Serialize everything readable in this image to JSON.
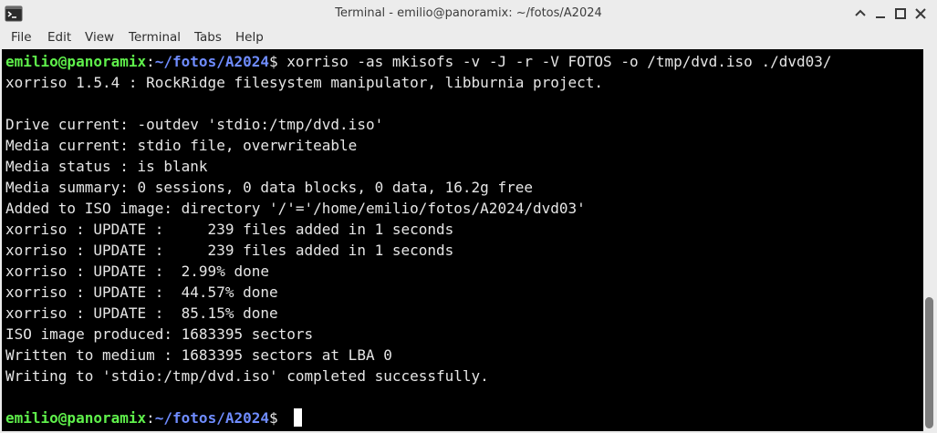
{
  "window": {
    "title": "Terminal - emilio@panoramix: ~/fotos/A2024",
    "app_icon": "terminal-icon",
    "controls": [
      "minimize-up-icon",
      "minimize-icon",
      "maximize-icon",
      "close-icon"
    ]
  },
  "menu": {
    "items": [
      "File",
      "Edit",
      "View",
      "Terminal",
      "Tabs",
      "Help"
    ]
  },
  "terminal": {
    "prompt": {
      "user": "emilio@panoramix",
      "sep": ":",
      "path": "~/fotos/A2024",
      "symbol": "$ "
    },
    "command": "xorriso -as mkisofs -v -J -r -V FOTOS -o /tmp/dvd.iso ./dvd03/",
    "output": [
      "xorriso 1.5.4 : RockRidge filesystem manipulator, libburnia project.",
      "",
      "Drive current: -outdev 'stdio:/tmp/dvd.iso'",
      "Media current: stdio file, overwriteable",
      "Media status : is blank",
      "Media summary: 0 sessions, 0 data blocks, 0 data, 16.2g free",
      "Added to ISO image: directory '/'='/home/emilio/fotos/A2024/dvd03'",
      "xorriso : UPDATE :     239 files added in 1 seconds",
      "xorriso : UPDATE :     239 files added in 1 seconds",
      "xorriso : UPDATE :  2.99% done",
      "xorriso : UPDATE :  44.57% done",
      "xorriso : UPDATE :  85.15% done",
      "ISO image produced: 1683395 sectors",
      "Written to medium : 1683395 sectors at LBA 0",
      "Writing to 'stdio:/tmp/dvd.iso' completed successfully.",
      ""
    ],
    "colors": {
      "background": "#000000",
      "text": "#e6e6e6",
      "user": "#5ff04b",
      "path": "#6f8cff"
    }
  }
}
